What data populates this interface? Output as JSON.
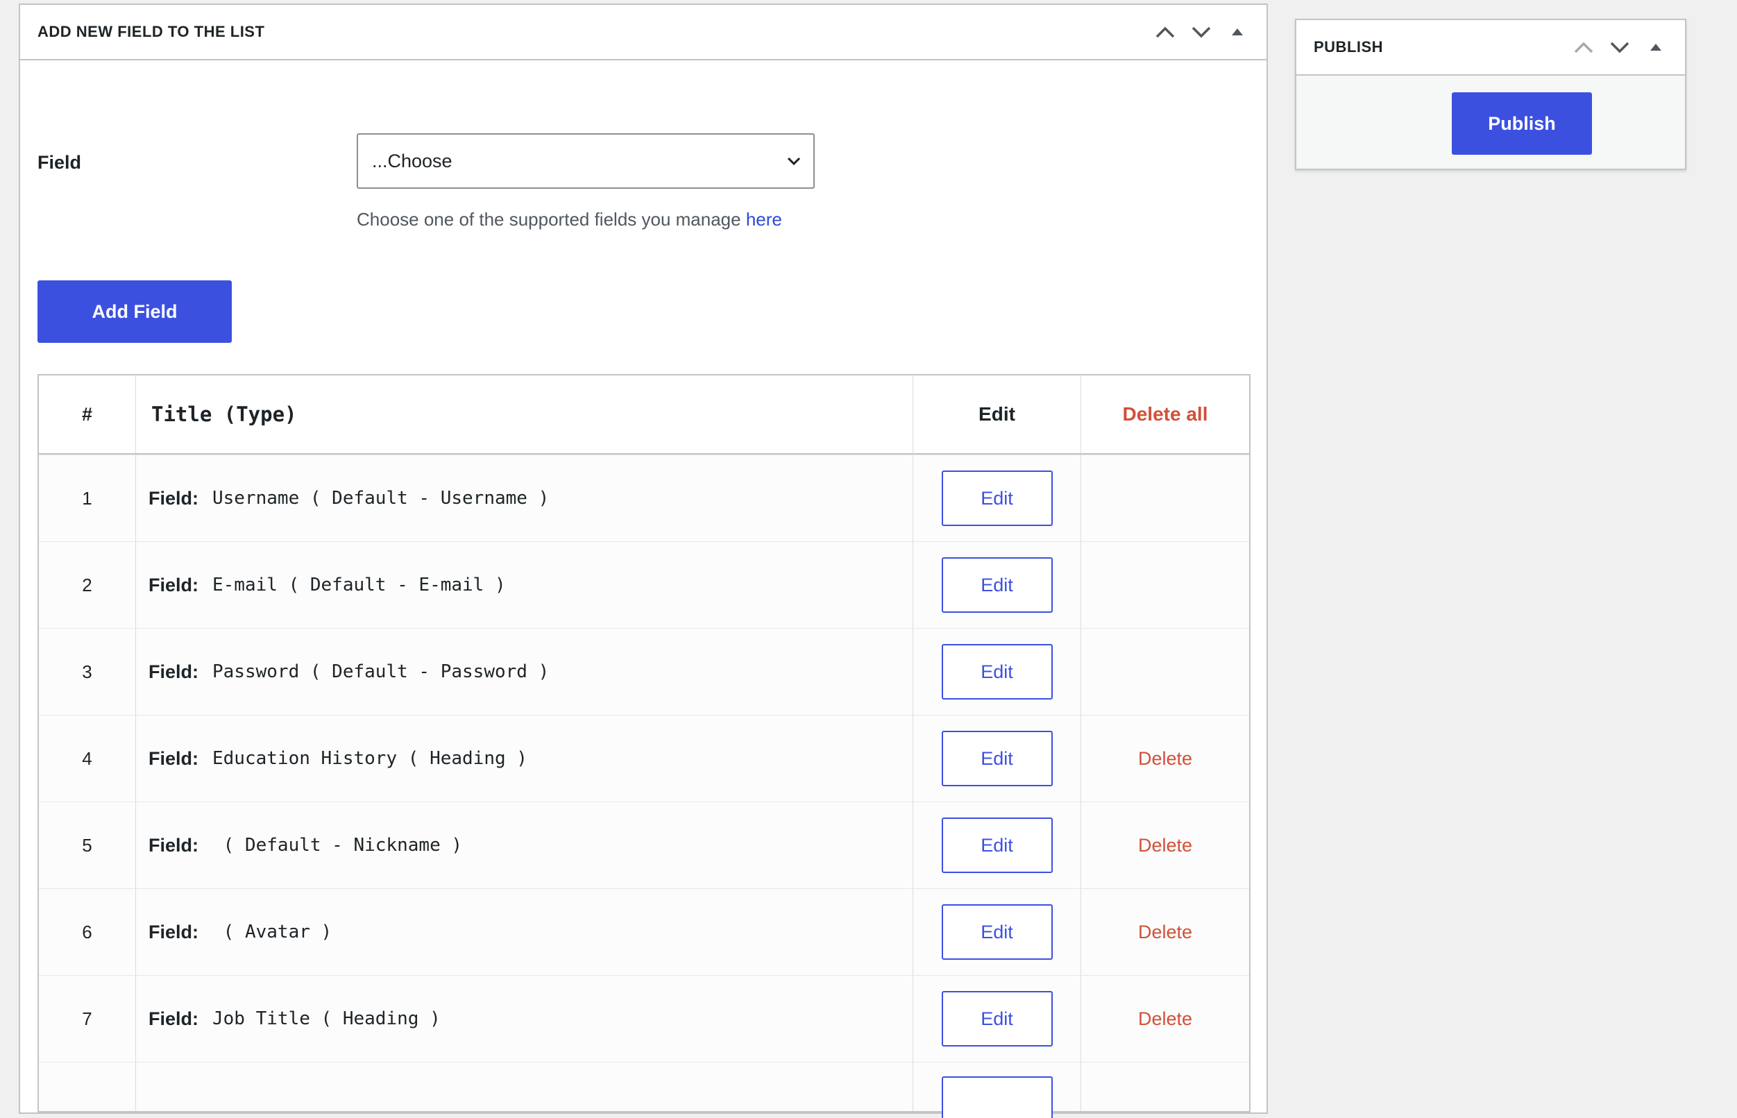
{
  "main_box": {
    "title": "ADD NEW FIELD TO THE LIST",
    "controls": [
      "chevron-up-icon",
      "chevron-down-icon",
      "caret-up-icon"
    ]
  },
  "field_form": {
    "label": "Field",
    "select_value": "...Choose",
    "help_text": "Choose one of the supported fields you manage",
    "help_link": "here",
    "add_button": "Add Field"
  },
  "table": {
    "headers": {
      "num": "#",
      "title": "Title (Type)",
      "edit": "Edit",
      "delete_all": "Delete all"
    },
    "field_prefix": "Field:",
    "edit_label": "Edit",
    "delete_label": "Delete",
    "rows": [
      {
        "num": "1",
        "value": "Username ( Default - Username )",
        "delete": ""
      },
      {
        "num": "2",
        "value": "E-mail ( Default - E-mail )",
        "delete": ""
      },
      {
        "num": "3",
        "value": "Password ( Default - Password )",
        "delete": ""
      },
      {
        "num": "4",
        "value": "Education History ( Heading )",
        "delete": "Delete"
      },
      {
        "num": "5",
        "value": " ( Default - Nickname )",
        "delete": "Delete"
      },
      {
        "num": "6",
        "value": " ( Avatar )",
        "delete": "Delete"
      },
      {
        "num": "7",
        "value": "Job Title ( Heading )",
        "delete": "Delete"
      }
    ]
  },
  "publish_box": {
    "title": "PUBLISH",
    "button": "Publish",
    "controls": [
      "chevron-up-icon",
      "chevron-down-icon",
      "caret-up-icon"
    ]
  },
  "colors": {
    "primary": "#3c50e0",
    "danger": "#d1503a",
    "border": "#c3c4c7",
    "background": "#f0f0f1"
  }
}
